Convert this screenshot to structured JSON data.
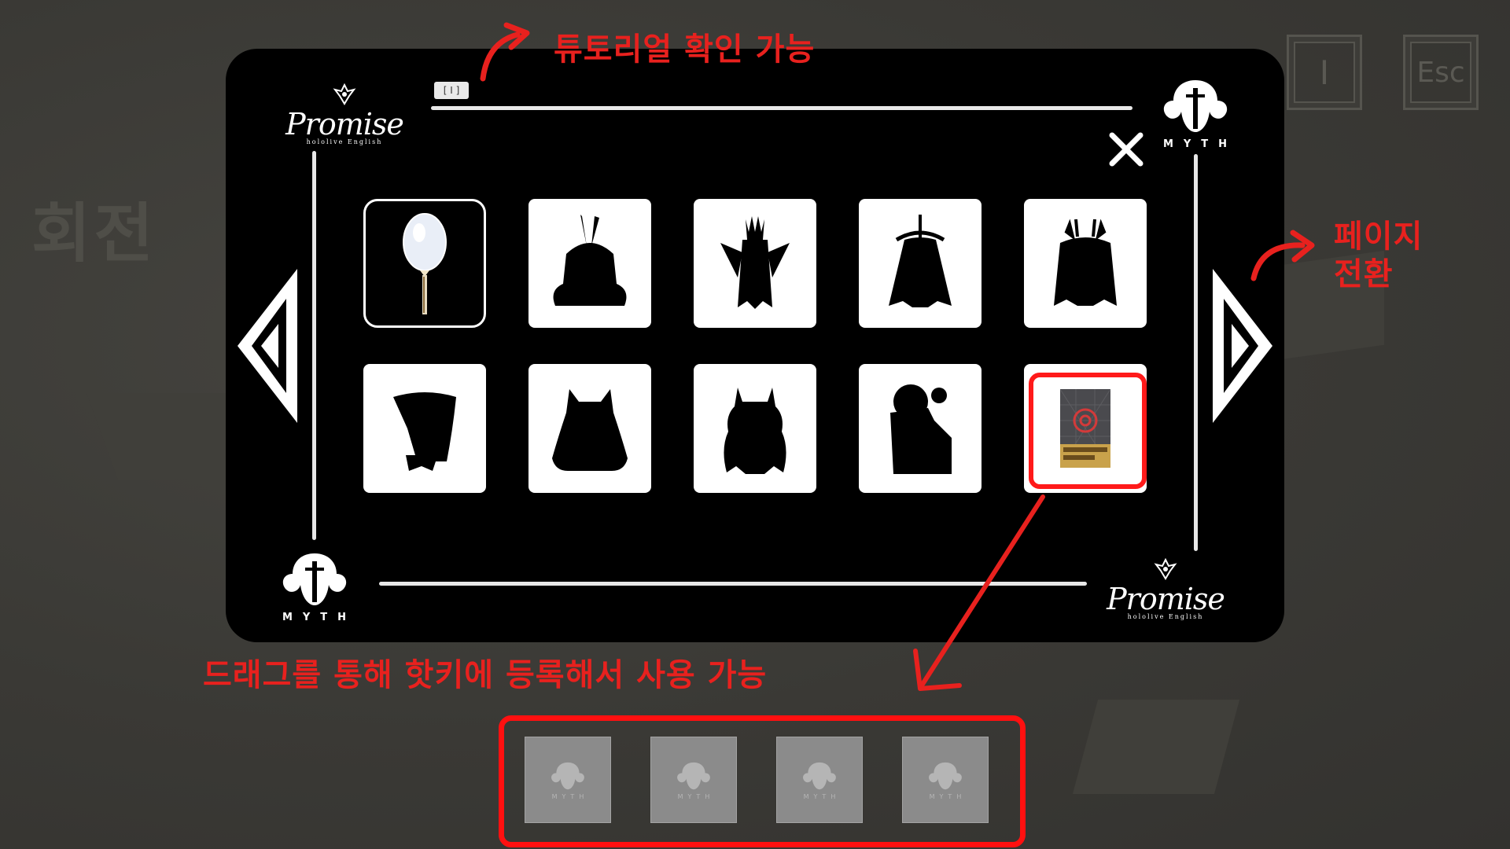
{
  "background": {
    "title": "회전"
  },
  "keys": {
    "inventory_key": "I",
    "escape_key": "Esc"
  },
  "panel": {
    "tutorial_badge": "[ I ]",
    "logo_promise_word": "Promise",
    "logo_promise_sub": "hololive English",
    "logo_myth_word": "MYTH",
    "close_icon": "close-x-icon",
    "prev_icon": "triangle-left-icon",
    "next_icon": "triangle-right-icon"
  },
  "inventory": {
    "items": [
      {
        "name": "white-balloon",
        "state": "selected"
      },
      {
        "name": "silhouette-feather-ears",
        "state": "locked"
      },
      {
        "name": "silhouette-crown-wings",
        "state": "locked"
      },
      {
        "name": "silhouette-halo-robe",
        "state": "locked"
      },
      {
        "name": "silhouette-antlers-robe",
        "state": "locked"
      },
      {
        "name": "silhouette-hood-tail",
        "state": "locked"
      },
      {
        "name": "silhouette-cat-ears",
        "state": "locked"
      },
      {
        "name": "silhouette-horns",
        "state": "locked"
      },
      {
        "name": "silhouette-house",
        "state": "locked"
      },
      {
        "name": "target-book",
        "state": "available"
      }
    ]
  },
  "annotations": {
    "tutorial": "튜토리얼  확인  가능",
    "page_switch_line1": "페이지",
    "page_switch_line2": "전환",
    "hotkey": "드래그를  통해  핫키에  등록해서  사용  가능"
  },
  "hotbar": {
    "slots": [
      {
        "label": "MYTH"
      },
      {
        "label": "MYTH"
      },
      {
        "label": "MYTH"
      },
      {
        "label": "MYTH"
      }
    ]
  },
  "colors": {
    "annotation_red": "#e8211e",
    "panel_bg": "#000000",
    "scene_bg": "#3b3a36"
  }
}
